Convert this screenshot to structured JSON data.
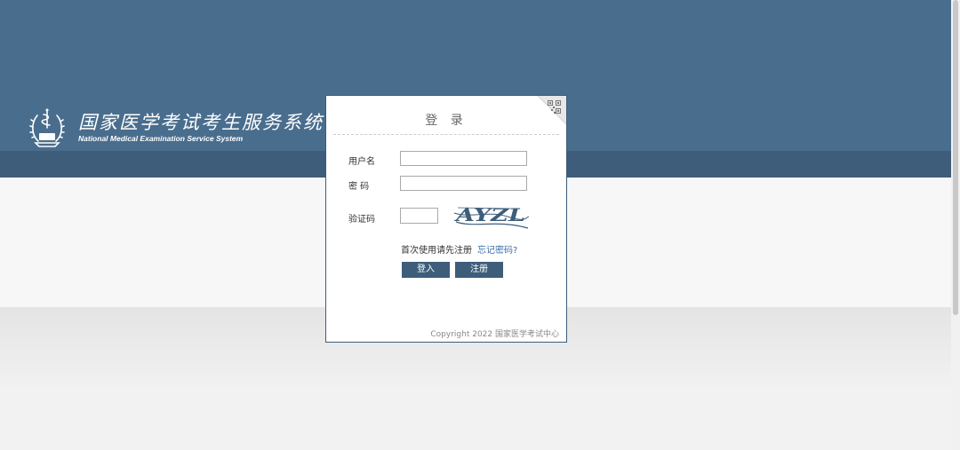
{
  "brand": {
    "title_cn": "国家医学考试考生服务系统",
    "title_en": "National Medical Examination Service System"
  },
  "login": {
    "title": "登 录",
    "username_label": "用户名",
    "username_value": "",
    "password_label": "密 码",
    "password_value": "",
    "captcha_label": "验证码",
    "captcha_value": "",
    "captcha_text": "AYZL",
    "first_use_text": "首次使用请先注册",
    "forgot_link": "忘记密码?",
    "login_button": "登入",
    "register_button": "注册",
    "copyright": "Copyright 2022 国家医学考试中心"
  },
  "icons": {
    "emblem": "medical-emblem-icon",
    "qr_corner": "qr-code-icon"
  },
  "colors": {
    "header_blue": "#496d8d",
    "dark_blue": "#3d5d7a",
    "link_blue": "#3d6fa8"
  }
}
